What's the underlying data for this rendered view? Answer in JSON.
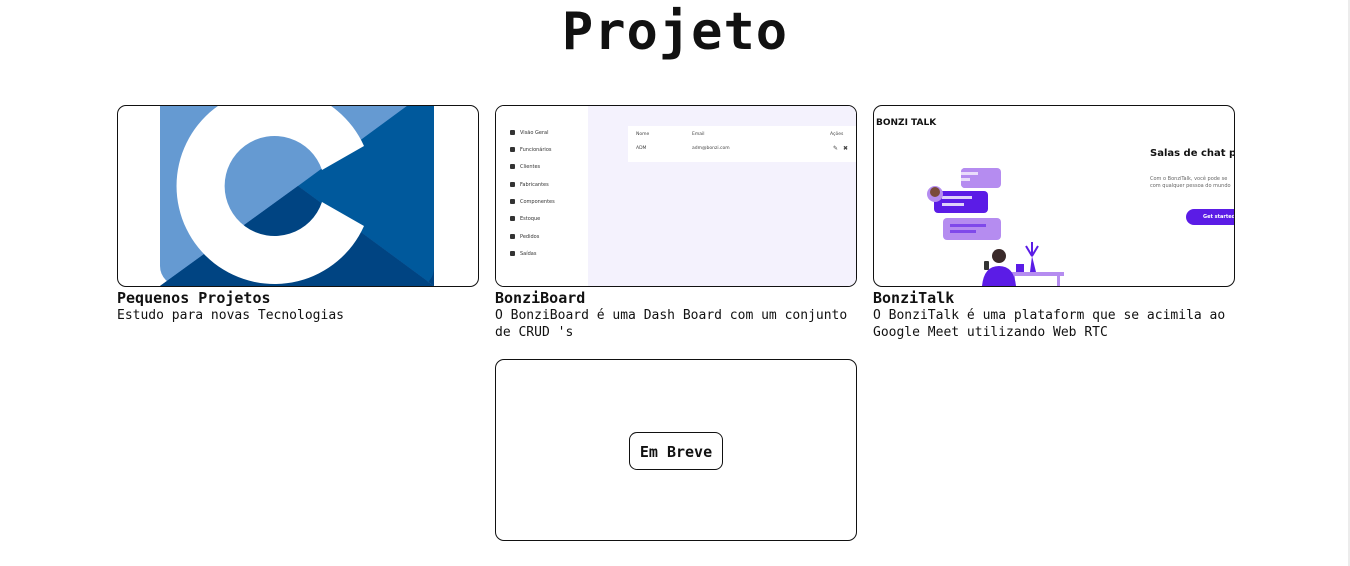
{
  "page": {
    "title": "Projeto"
  },
  "projects": [
    {
      "title": "Pequenos Projetos",
      "description": "Estudo para novas Tecnologias"
    },
    {
      "title": "BonziBoard",
      "description": "O BonziBoard é uma Dash Board com um conjunto\nde CRUD 's",
      "preview": {
        "menu": [
          "Visão Geral",
          "Funcionários",
          "Clientes",
          "Fabricantes",
          "Componentes",
          "Estoque",
          "Pedidos",
          "Saídas"
        ],
        "table_headers": [
          "Nome",
          "Email",
          "Ações"
        ],
        "table_row": [
          "ADM",
          "adm@bonzi.com"
        ]
      }
    },
    {
      "title": "BonziTalk",
      "description": "O BonziTalk é uma plataform que se acimila ao\nGoogle Meet utilizando Web RTC",
      "preview": {
        "brand": "BONZI TALK",
        "heading": "Salas de chat para",
        "subtext": "Com o BonziTalk, você pode se\ncom qualquer pessoa do mundo",
        "cta": "Get started"
      }
    },
    {
      "placeholder_label": "Em Breve"
    }
  ],
  "colors": {
    "accent": "#5b1ce6",
    "lavender": "#b58cf0",
    "dashboard_bg": "#f4f2fd",
    "c_logo_light": "#659ad2",
    "c_logo_dark": "#00599c",
    "c_logo_deep": "#004482"
  }
}
